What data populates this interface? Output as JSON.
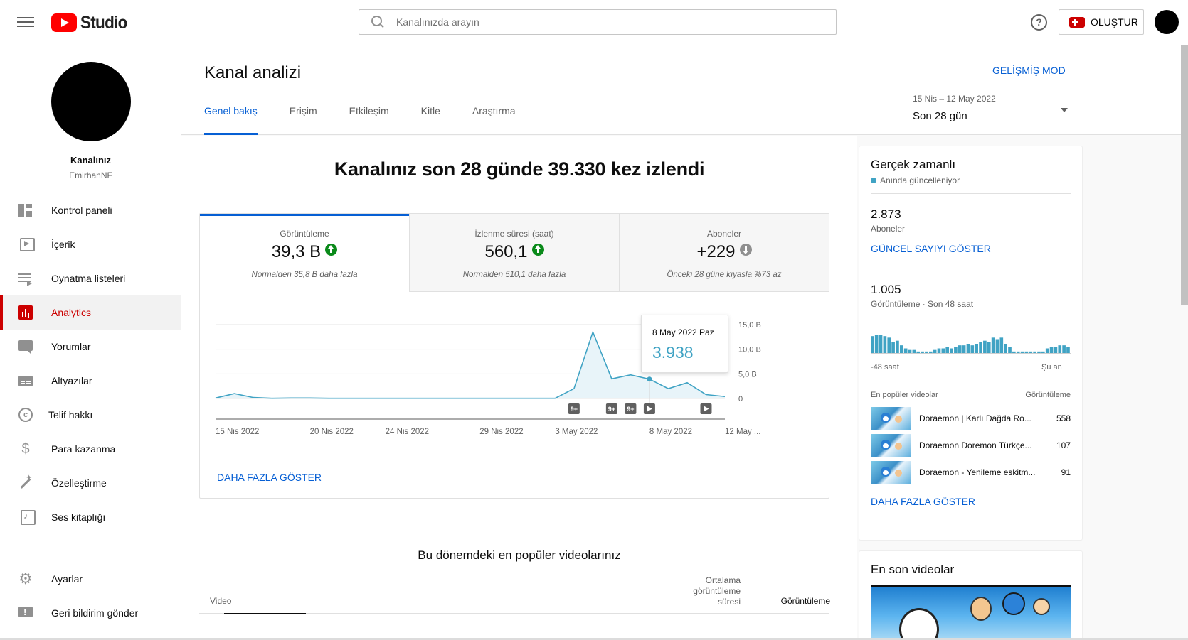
{
  "topbar": {
    "logo_text": "Studio",
    "search_placeholder": "Kanalınızda arayın",
    "help": "?",
    "create_label": "OLUŞTUR"
  },
  "sidebar": {
    "channel_title": "Kanalınız",
    "channel_name": "EmirhanNF",
    "items": [
      {
        "label": "Kontrol paneli",
        "icon": "dashboard-icon"
      },
      {
        "label": "İçerik",
        "icon": "content-icon"
      },
      {
        "label": "Oynatma listeleri",
        "icon": "playlist-icon"
      },
      {
        "label": "Analytics",
        "icon": "analytics-icon"
      },
      {
        "label": "Yorumlar",
        "icon": "comments-icon"
      },
      {
        "label": "Altyazılar",
        "icon": "subtitles-icon"
      },
      {
        "label": "Telif hakkı",
        "icon": "copyright-icon"
      },
      {
        "label": "Para kazanma",
        "icon": "dollar-icon"
      },
      {
        "label": "Özelleştirme",
        "icon": "magic-wand-icon"
      },
      {
        "label": "Ses kitaplığı",
        "icon": "audio-library-icon"
      }
    ],
    "bottom": [
      {
        "label": "Ayarlar",
        "icon": "gear-icon"
      },
      {
        "label": "Geri bildirim gönder",
        "icon": "feedback-icon"
      }
    ]
  },
  "header": {
    "title": "Kanal analizi",
    "advanced_mode": "GELİŞMİŞ MOD",
    "tabs": [
      "Genel bakış",
      "Erişim",
      "Etkileşim",
      "Kitle",
      "Araştırma"
    ],
    "date_range": "15 Nis – 12 May 2022",
    "date_label": "Son 28 gün"
  },
  "overview": {
    "headline": "Kanalınız son 28 günde 39.330 kez izlendi",
    "metrics": [
      {
        "label": "Görüntüleme",
        "value": "39,3 B",
        "trend": "up",
        "note": "Normalden 35,8 B daha fazla"
      },
      {
        "label": "İzlenme süresi (saat)",
        "value": "560,1",
        "trend": "up",
        "note": "Normalden 510,1 daha fazla"
      },
      {
        "label": "Aboneler",
        "value": "+229",
        "trend": "down",
        "note": "Önceki 28 güne kıyasla %73 az"
      }
    ],
    "tooltip": {
      "date": "8 May 2022 Paz",
      "value": "3.938"
    },
    "show_more": "DAHA FAZLA GÖSTER",
    "top_videos_title": "Bu dönemdeki en popüler videolarınız",
    "table_headers": {
      "video": "Video",
      "avg_line1": "Ortalama",
      "avg_line2": "görüntüleme",
      "avg_line3": "süresi",
      "views": "Görüntüleme"
    }
  },
  "chart_data": {
    "type": "area",
    "x": [
      "15 Nis 2022",
      "16 Nis",
      "17 Nis",
      "18 Nis",
      "19 Nis",
      "20 Nis 2022",
      "21 Nis",
      "22 Nis",
      "23 Nis",
      "24 Nis 2022",
      "25 Nis",
      "26 Nis",
      "27 Nis",
      "28 Nis",
      "29 Nis 2022",
      "30 Nis",
      "1 May",
      "2 May",
      "3 May 2022",
      "4 May",
      "5 May",
      "6 May",
      "7 May",
      "8 May 2022",
      "9 May",
      "10 May",
      "11 May",
      "12 May 2022"
    ],
    "x_tick_labels": [
      "15 Nis 2022",
      "20 Nis 2022",
      "24 Nis 2022",
      "29 Nis 2022",
      "3 May 2022",
      "8 May 2022",
      "12 May ..."
    ],
    "x_tick_indices": [
      0,
      5,
      9,
      14,
      18,
      23,
      27
    ],
    "values": [
      100,
      1000,
      200,
      50,
      100,
      100,
      50,
      50,
      50,
      50,
      50,
      50,
      50,
      50,
      50,
      50,
      50,
      50,
      50,
      2000,
      13500,
      4000,
      4800,
      3938,
      2000,
      3200,
      800,
      400
    ],
    "ylim": [
      0,
      15000
    ],
    "y_ticks": [
      0,
      5000,
      10000,
      15000
    ],
    "y_tick_labels": [
      "0",
      "5,0 B",
      "10,0 B",
      "15,0 B"
    ],
    "highlight_index": 23,
    "markers": [
      {
        "index": 19,
        "label": "9+",
        "kind": "badge"
      },
      {
        "index": 21,
        "label": "9+",
        "kind": "badge"
      },
      {
        "index": 22,
        "label": "9+",
        "kind": "badge"
      },
      {
        "index": 23,
        "label": "",
        "kind": "play"
      },
      {
        "index": 26,
        "label": "",
        "kind": "play"
      }
    ],
    "line_color": "#40a3c4",
    "fill_color": "#e8f4f9"
  },
  "realtime": {
    "title": "Gerçek zamanlı",
    "subtitle": "Anında güncelleniyor",
    "subscribers_value": "2.873",
    "subscribers_label": "Aboneler",
    "show_count": "GÜNCEL SAYIYI GÖSTER",
    "views_value": "1.005",
    "views_label": "Görüntüleme · Son 48 saat",
    "axis_left": "-48 saat",
    "axis_right": "Şu an",
    "bars": [
      22,
      24,
      24,
      22,
      20,
      14,
      16,
      10,
      6,
      4,
      4,
      2,
      2,
      2,
      2,
      4,
      6,
      6,
      8,
      6,
      8,
      10,
      10,
      12,
      10,
      12,
      14,
      16,
      14,
      20,
      18,
      20,
      12,
      8,
      2,
      2,
      2,
      2,
      2,
      2,
      2,
      2,
      6,
      8,
      8,
      10,
      10,
      8
    ],
    "popular_header": "En popüler videolar",
    "views_header": "Görüntüleme",
    "videos": [
      {
        "title": "Doraemon | Karlı Dağda Ro...",
        "views": "558"
      },
      {
        "title": "Doraemon Doremon Türkçe...",
        "views": "107"
      },
      {
        "title": "Doraemon - Yenileme eskitm...",
        "views": "91"
      }
    ],
    "show_more": "DAHA FAZLA GÖSTER"
  },
  "latest": {
    "title": "En son videolar"
  }
}
